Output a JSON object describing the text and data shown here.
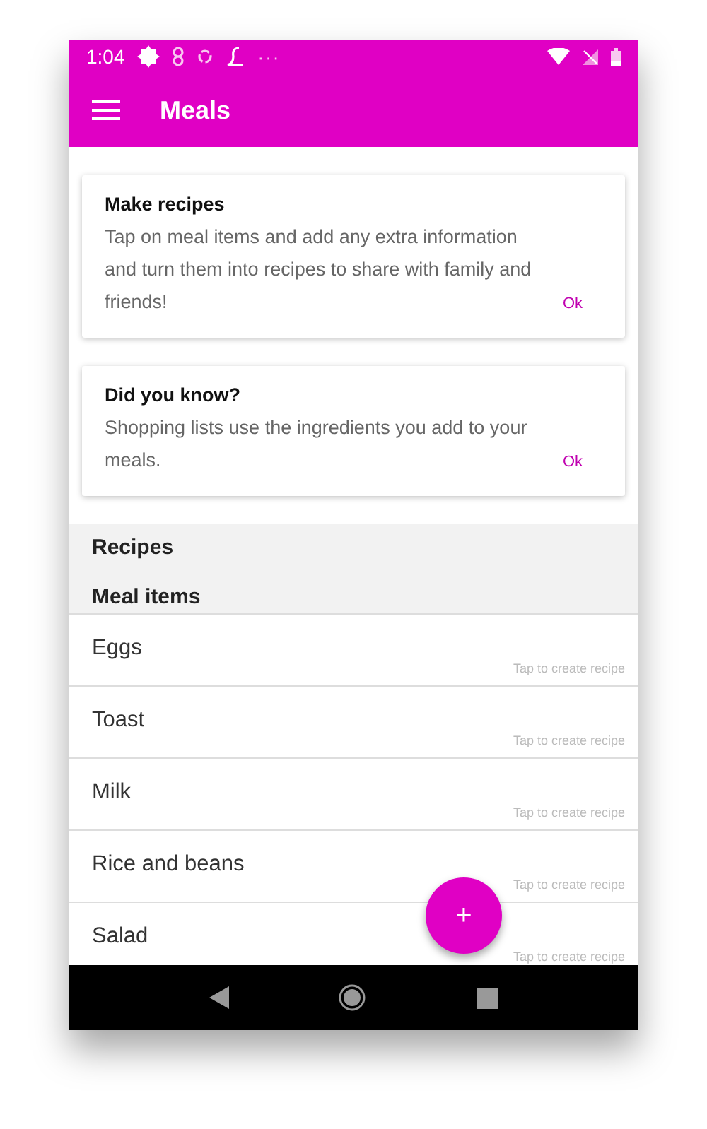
{
  "status_bar": {
    "time": "1:04",
    "more": "···"
  },
  "toolbar": {
    "title": "Meals"
  },
  "tips": [
    {
      "title": "Make recipes",
      "body": "Tap on meal items and add any extra information and turn them into recipes to share with family and friends!",
      "action": "Ok"
    },
    {
      "title": "Did you know?",
      "body": "Shopping lists use the ingredients you add to your meals.",
      "action": "Ok"
    }
  ],
  "sections": [
    "Recipes",
    "Meal items"
  ],
  "meal_items": [
    {
      "name": "Eggs",
      "hint": "Tap to create recipe"
    },
    {
      "name": "Toast",
      "hint": "Tap to create recipe"
    },
    {
      "name": "Milk",
      "hint": "Tap to create recipe"
    },
    {
      "name": "Rice and beans",
      "hint": "Tap to create recipe"
    },
    {
      "name": "Salad",
      "hint": "Tap to create recipe"
    }
  ],
  "fab": {
    "label": "+"
  }
}
